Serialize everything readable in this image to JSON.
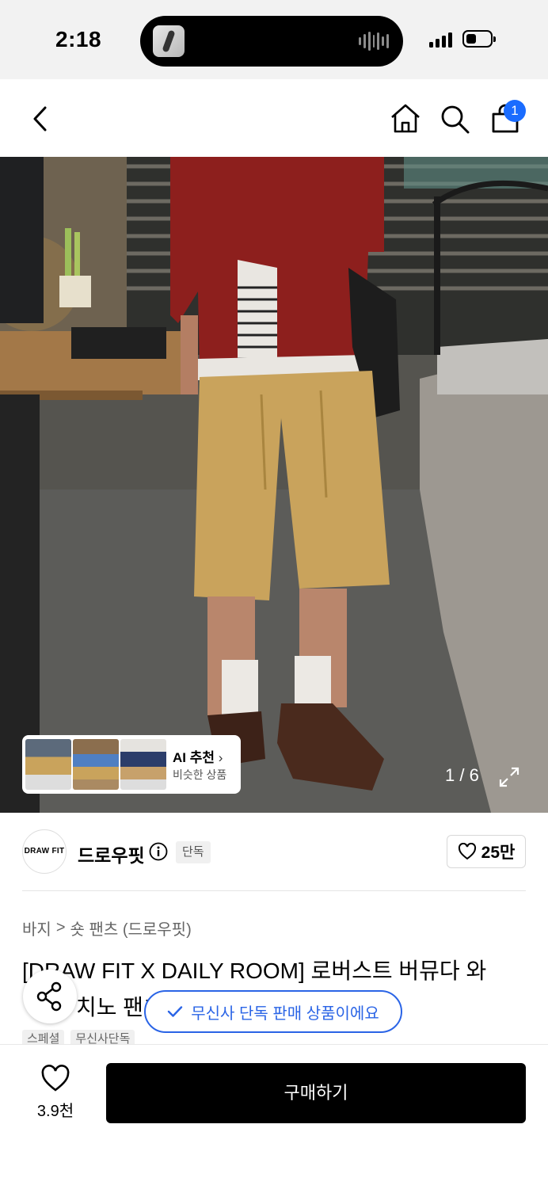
{
  "status_bar": {
    "time": "2:18"
  },
  "nav": {
    "cart_count": "1"
  },
  "gallery": {
    "counter": "1 / 6",
    "ai_title": "AI 추천",
    "ai_subtitle": "비슷한 상품"
  },
  "brand": {
    "logo_text": "DRAW FIT",
    "name": "드로우핏",
    "exclusive_badge": "단독",
    "likes": "25만"
  },
  "breadcrumb": {
    "category": "바지",
    "separator": ">",
    "subcategory": "숏 팬츠 (드로우핏)"
  },
  "product": {
    "title_line1": "[DRAW FIT X DAILY ROOM] 로버스트 버뮤다 와",
    "title_line2": "치노 팬츠",
    "tags": [
      "스페셜",
      "무신사단독"
    ]
  },
  "toast": {
    "message": "무신사 단독 판매 상품이에요"
  },
  "bottom_bar": {
    "wish_count": "3.9천",
    "buy_label": "구매하기"
  },
  "colors": {
    "accent_blue": "#2a64e6",
    "badge_blue": "#1a6cff"
  }
}
